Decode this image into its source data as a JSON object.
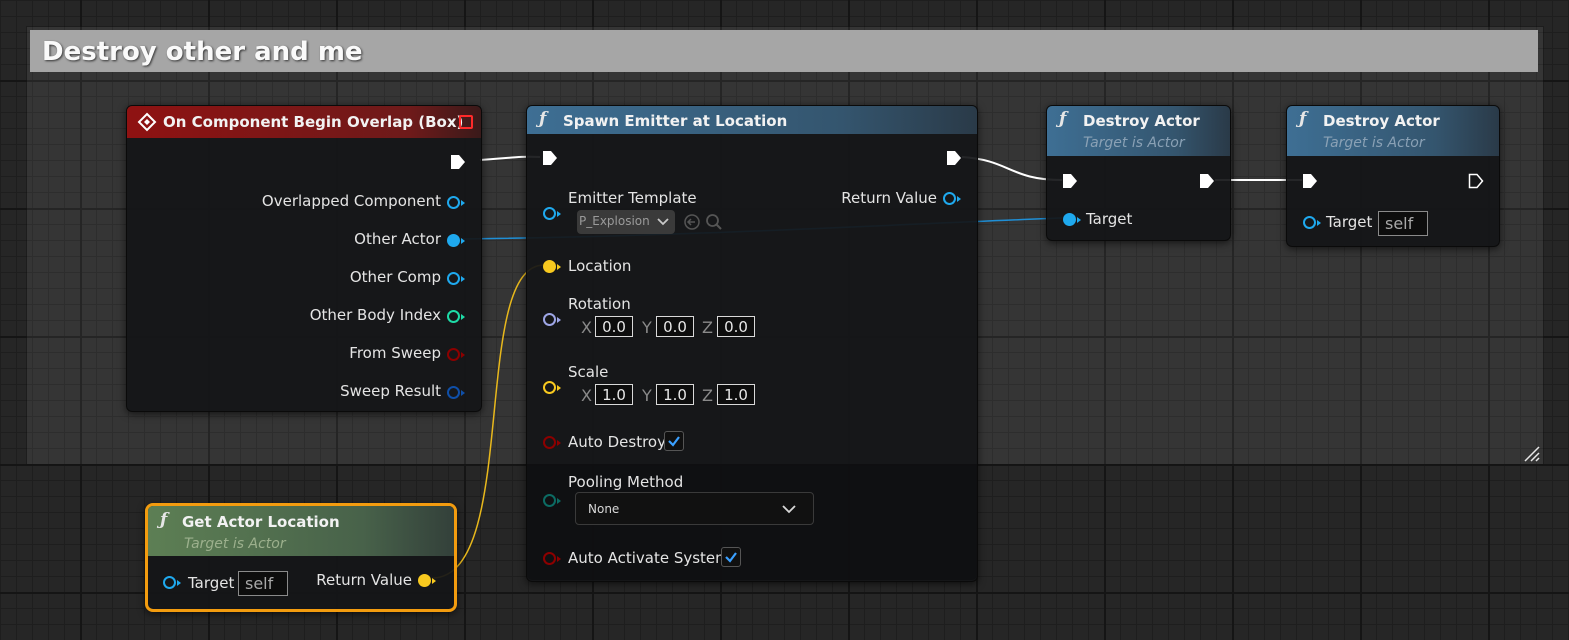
{
  "comment": {
    "title": "Destroy other and me"
  },
  "overlap_node": {
    "title": "On Component Begin Overlap (Box)",
    "pins": [
      "Overlapped Component",
      "Other Actor",
      "Other Comp",
      "Other Body Index",
      "From Sweep",
      "Sweep Result"
    ]
  },
  "spawn_node": {
    "title": "Spawn Emitter at Location",
    "emitter_template_label": "Emitter Template",
    "emitter_template_value": "P_Explosion",
    "return_value_label": "Return Value",
    "location_label": "Location",
    "rotation_label": "Rotation",
    "rotation": {
      "x": "0.0",
      "y": "0.0",
      "z": "0.0"
    },
    "scale_label": "Scale",
    "scale": {
      "x": "1.0",
      "y": "1.0",
      "z": "1.0"
    },
    "axis_labels": {
      "x": "X",
      "y": "Y",
      "z": "Z"
    },
    "auto_destroy_label": "Auto Destroy",
    "auto_destroy": true,
    "pooling_method_label": "Pooling Method",
    "pooling_method_value": "None",
    "auto_activate_label": "Auto Activate System",
    "auto_activate": true
  },
  "destroy_node_1": {
    "title": "Destroy Actor",
    "subtitle": "Target is Actor",
    "target_label": "Target"
  },
  "destroy_node_2": {
    "title": "Destroy Actor",
    "subtitle": "Target is Actor",
    "target_label": "Target",
    "target_value": "self"
  },
  "get_location_node": {
    "title": "Get Actor Location",
    "subtitle": "Target is Actor",
    "target_label": "Target",
    "target_value": "self",
    "return_value_label": "Return Value"
  },
  "colors": {
    "event_header": "#8f1212",
    "function_header": "#3e6f94",
    "pure_header": "#5d7f54",
    "object_pin": "#1fa9ee",
    "vector_pin": "#f8c91f",
    "rotator_pin": "#9ea6e6",
    "int_pin": "#1edba7",
    "bool_pin": "#8c0000",
    "struct_pin": "#0f4fa8",
    "enum_pin": "#0c6b63",
    "selected_outline": "#f39c0f"
  }
}
